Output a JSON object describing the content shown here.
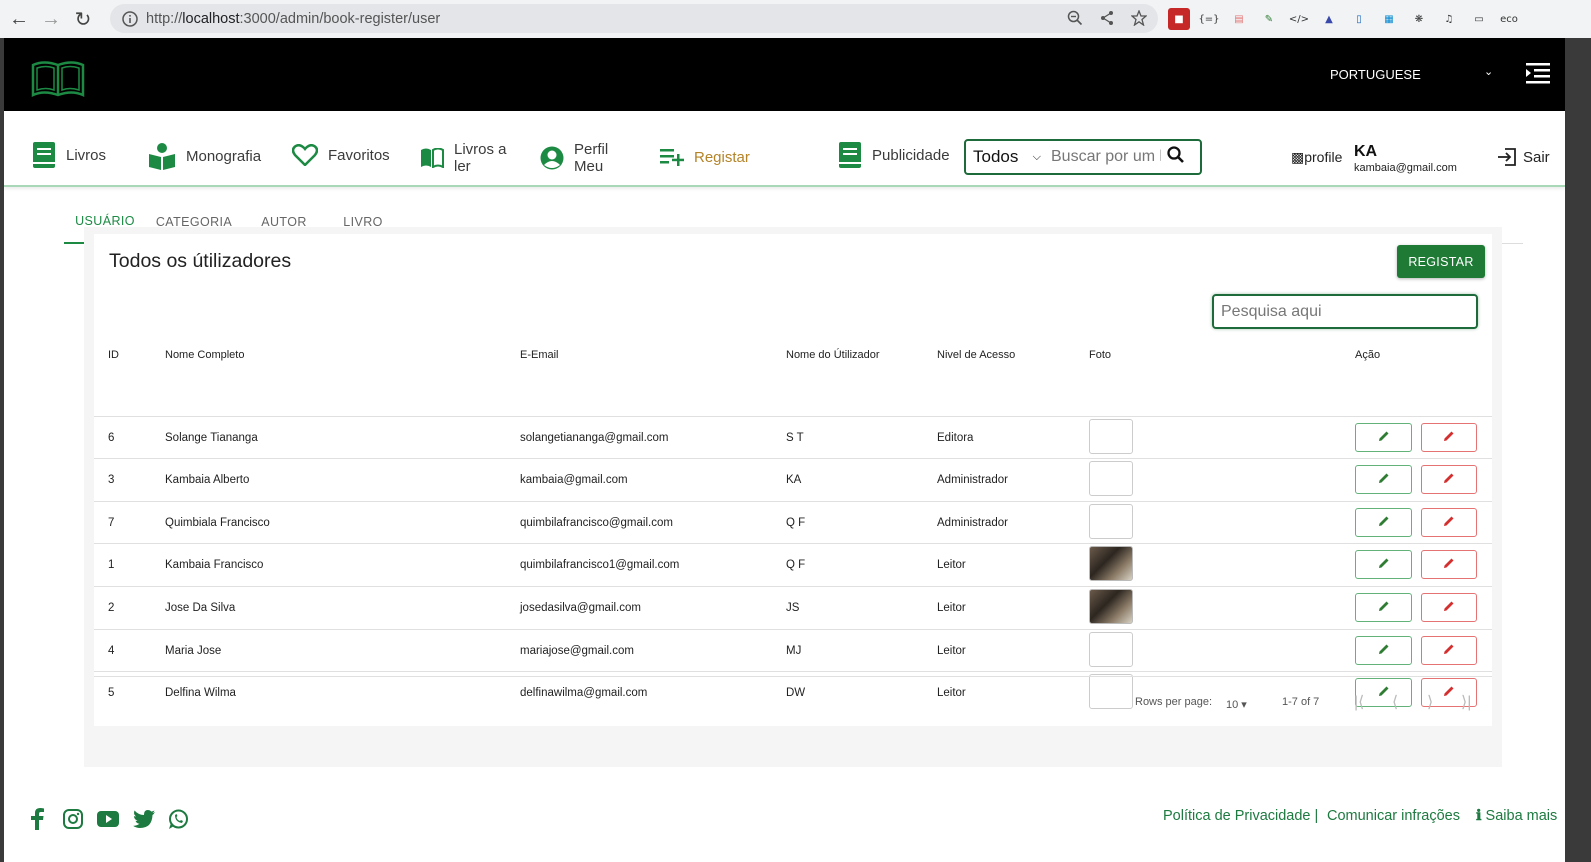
{
  "browser": {
    "url_prefix": "http://",
    "url_host": "localhost",
    "url_path": ":3000/admin/book-register/user"
  },
  "topbar": {
    "language": "PORTUGUESE"
  },
  "nav": {
    "items": [
      {
        "label": "Livros"
      },
      {
        "label": "Monografia"
      },
      {
        "label": "Favoritos"
      },
      {
        "label_line1": "Livros a",
        "label_line2": "ler"
      },
      {
        "label_line1": "Perfil",
        "label_line2": "Meu"
      },
      {
        "label": "Registar"
      },
      {
        "label": "Publicidade"
      }
    ],
    "search_select": "Todos",
    "search_placeholder": "Buscar por um l",
    "profile_alt": "profile",
    "profile_initials": "KA",
    "profile_email": "kambaia@gmail.com",
    "logout": "Sair"
  },
  "tabs": [
    "USUÁRIO",
    "CATEGORIA",
    "AUTOR",
    "LIVRO"
  ],
  "card": {
    "title": "Todos os útilizadores",
    "register_button": "REGISTAR",
    "search_placeholder": "Pesquisa aqui"
  },
  "table": {
    "headers": [
      "ID",
      "Nome Completo",
      "E-Email",
      "Nome do Útilizador",
      "Nivel de Acesso",
      "Foto",
      "Ação"
    ],
    "rows": [
      {
        "id": "6",
        "name": "Solange Tiananga",
        "email": "solangetiananga@gmail.com",
        "user": "S T",
        "level": "Editora",
        "photo": false
      },
      {
        "id": "3",
        "name": "Kambaia Alberto",
        "email": "kambaia@gmail.com",
        "user": "KA",
        "level": "Administrador",
        "photo": false
      },
      {
        "id": "7",
        "name": "Quimbiala Francisco",
        "email": "quimbilafrancisco@gmail.com",
        "user": "Q F",
        "level": "Administrador",
        "photo": false
      },
      {
        "id": "1",
        "name": "Kambaia Francisco",
        "email": "quimbilafrancisco1@gmail.com",
        "user": "Q F",
        "level": "Leitor",
        "photo": true
      },
      {
        "id": "2",
        "name": "Jose Da Silva",
        "email": "josedasilva@gmail.com",
        "user": "JS",
        "level": "Leitor",
        "photo": true
      },
      {
        "id": "4",
        "name": "Maria Jose",
        "email": "mariajose@gmail.com",
        "user": "MJ",
        "level": "Leitor",
        "photo": false
      },
      {
        "id": "5",
        "name": "Delfina Wilma",
        "email": "delfinawilma@gmail.com",
        "user": "DW",
        "level": "Leitor",
        "photo": false
      }
    ]
  },
  "pagination": {
    "rows_per_page_label": "Rows per page:",
    "rows_per_page": "10",
    "range": "1-7 of 7"
  },
  "footer": {
    "privacy": "Política de Privacidade |",
    "report": "Comunicar infrações",
    "more": "Saiba mais"
  },
  "colors": {
    "brand_green": "#1e7a35",
    "danger_red": "#d32f2f",
    "active_nav": "#b48428"
  }
}
